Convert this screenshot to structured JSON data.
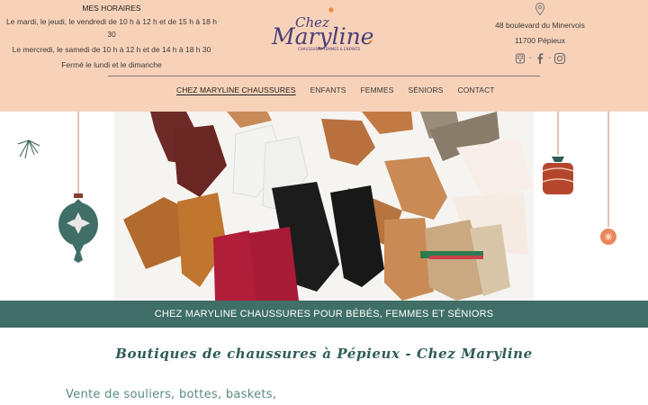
{
  "hours": {
    "title": "MES HORAIRES",
    "line1": "Le mardi, le jeudi, le vendredi de 10 h à 12 h et de 15 h à 18 h 30",
    "line2": "Le mercredi, le samedi de 10 h à 12 h et de 14 h à 18 h 30",
    "line3": "Fermé le lundi et le dimanche"
  },
  "logo": {
    "chez": "Chez",
    "name": "Maryline",
    "tagline": "CHAUSSURES FEMMES & ENFANTS"
  },
  "address": {
    "street": "48 boulevard du Minervois",
    "city": "11700 Pépieux",
    "icons": [
      "map-pin-icon",
      "phone-icon",
      "facebook-icon",
      "instagram-icon"
    ]
  },
  "nav": {
    "items": [
      "CHEZ MARYLINE CHAUSSURES",
      "ENFANTS",
      "FEMMES",
      "SÉNIORS",
      "CONTACT"
    ],
    "active": "CHEZ MARYLINE CHAUSSURES"
  },
  "banner": {
    "text": "CHEZ MARYLINE CHAUSSURES POUR BÉBÉS, FEMMES ET SÉNIORS"
  },
  "main": {
    "title": "Boutiques de chaussures à Pépieux - Chez Maryline",
    "subtitle": "Vente de souliers, bottes, baskets,"
  },
  "colors": {
    "header_bg": "#f8d2b8",
    "banner_bg": "#3f6f66",
    "title_color": "#2f5d57",
    "logo_purple": "#4a3f7a",
    "logo_orange": "#f08a3c"
  }
}
